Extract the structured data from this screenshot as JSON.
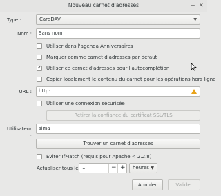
{
  "window": {
    "title": "Nouveau carnet d'adresses",
    "close_glyph": "✕",
    "minimize_glyph": "+"
  },
  "form": {
    "type_label": "Type :",
    "type_value": "CardDAV",
    "name_label": "Nom :",
    "name_value": "Sans nom",
    "checkboxes": [
      {
        "label": "Utiliser dans l'agenda Anniversaires",
        "checked": false
      },
      {
        "label": "Marquer comme carnet d'adresses par défaut",
        "checked": false
      },
      {
        "label": "Utiliser ce carnet d'adresses pour l'autocomplétion",
        "checked": true
      },
      {
        "label": "Copier localement le contenu du carnet pour les opérations hors ligne",
        "checked": false
      }
    ],
    "url_label": "URL :",
    "url_value": "http:",
    "secure_label": "Utiliser une connexion sécurisée",
    "retract_button": "Retirer la confiance du certificat SSL/TLS",
    "user_label": "Utilisateur :",
    "user_value": "sima",
    "find_button": "Trouver un carnet d'adresses",
    "ifmatch_label": "Éviter IfMatch (requis pour Apache < 2.2.8)",
    "refresh_label": "Actualiser tous les",
    "refresh_value": "1",
    "unit_value": "heures"
  },
  "buttons": {
    "cancel": "Annuler",
    "ok": "Valider"
  }
}
